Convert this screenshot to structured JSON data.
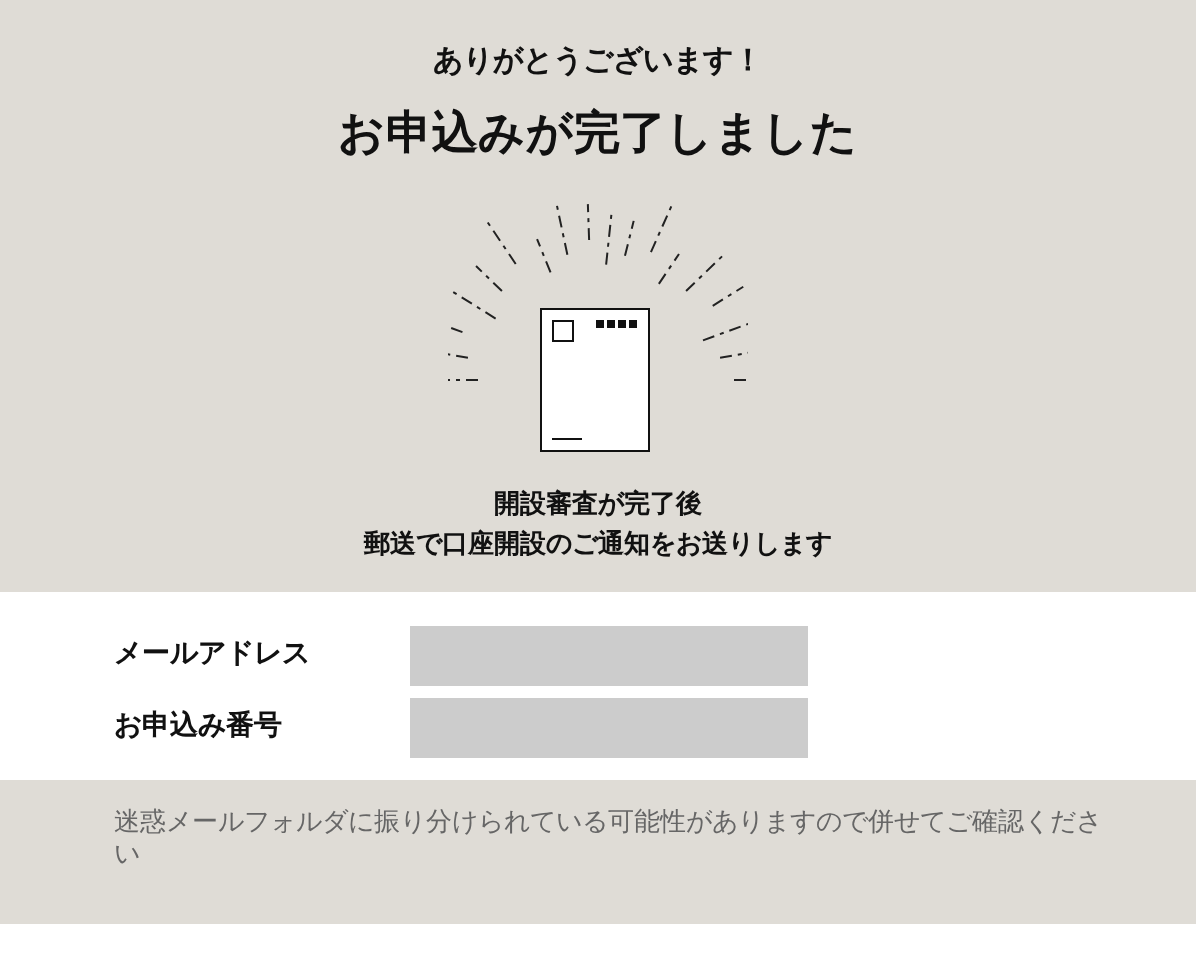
{
  "header": {
    "thanks": "ありがとうございます！",
    "title": "お申込みが完了しました",
    "message_lines": [
      "開設審査が完了後",
      "郵送で口座開設のご通知をお送りします"
    ]
  },
  "details": [
    {
      "label": "メールアドレス"
    },
    {
      "label": "お申込み番号"
    }
  ],
  "notice": "迷惑メールフォルダに振り分けられている可能性がありますので併せてご確認ください"
}
